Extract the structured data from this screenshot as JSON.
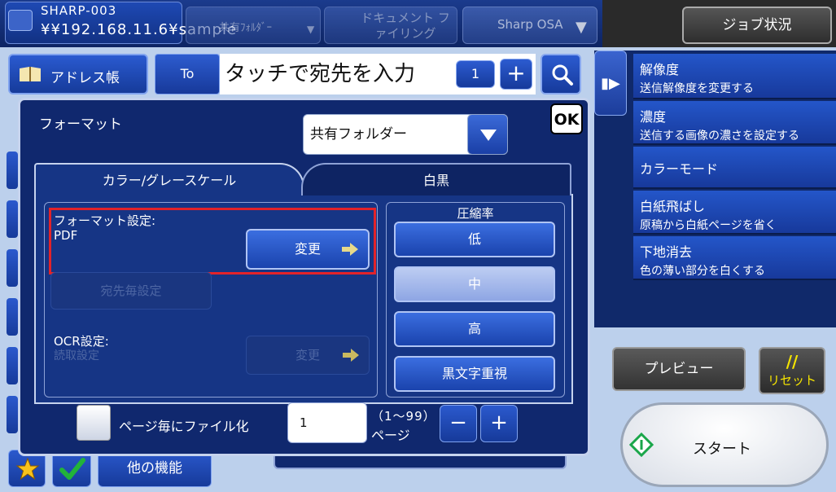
{
  "header": {
    "destination_name": "SHARP-003",
    "destination_path": "¥¥192.168.11.6¥sample",
    "mode_tabs": [
      "共有ﾌｫﾙﾀﾞｰ",
      "ドキュメント ファイリング",
      "Sharp OSA"
    ],
    "job_status": "ジョブ状況"
  },
  "address_bar": {
    "address_book": "アドレス帳",
    "to": "To",
    "placeholder": "タッチで宛先を入力",
    "count": "1",
    "plus": "+"
  },
  "right_panel": {
    "items": [
      {
        "title": "解像度",
        "desc": "送信解像度を変更する"
      },
      {
        "title": "濃度",
        "desc": "送信する画像の濃さを設定する"
      },
      {
        "title": "カラーモード",
        "desc": ""
      },
      {
        "title": "白紙飛ばし",
        "desc": "原稿から白紙ページを省く"
      },
      {
        "title": "下地消去",
        "desc": "色の薄い部分を白くする"
      }
    ],
    "preview": "プレビュー",
    "reset_mark": "//",
    "reset": "リセット",
    "start": "スタート"
  },
  "bottom": {
    "other_functions": "他の機能"
  },
  "modal": {
    "title": "フォーマット",
    "ok": "OK",
    "destination_type": "共有フォルダー",
    "tabs": [
      "カラー/グレースケール",
      "白黒"
    ],
    "format_label": "フォーマット設定:",
    "format_value": "PDF",
    "change": "変更",
    "dest_specific": "宛先毎設定",
    "ocr_label": "OCR設定:",
    "ocr_value": "読取設定",
    "ocr_change": "変更",
    "compression": {
      "title": "圧縮率",
      "options": [
        "低",
        "中",
        "高",
        "黒文字重視"
      ],
      "selected": "中"
    },
    "file_per_page": "ページ毎にファイル化",
    "page_count": "1",
    "page_range": "（1～99）",
    "page_unit": "ページ",
    "minus": "−",
    "plus": "+"
  },
  "colors": {
    "highlight": "#e2232a",
    "brand_blue": "#1a43ad",
    "reset_yellow": "#f5e400"
  }
}
